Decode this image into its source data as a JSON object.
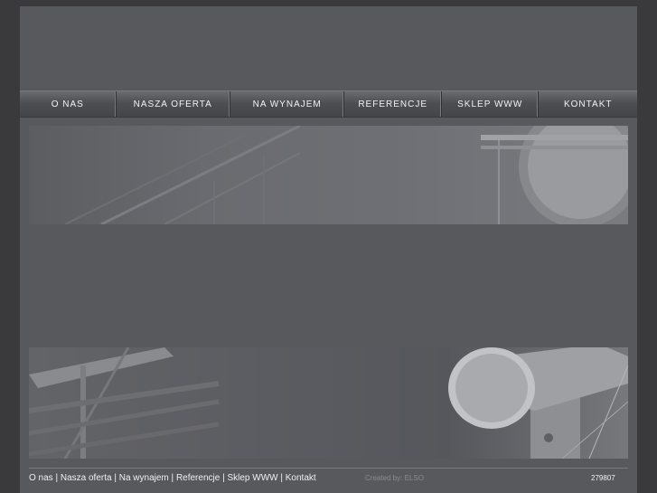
{
  "nav": {
    "items": [
      {
        "label": "O NAS"
      },
      {
        "label": "NASZA OFERTA"
      },
      {
        "label": "NA WYNAJEM"
      },
      {
        "label": "REFERENCJE"
      },
      {
        "label": "SKLEP WWW"
      },
      {
        "label": "KONTAKT"
      }
    ]
  },
  "footer": {
    "links": [
      "O nas",
      "Nasza oferta",
      "Na wynajem",
      "Referencje",
      "Sklep WWW",
      "Kontakt"
    ],
    "separator": "|",
    "created_by": "Created by: ELSO",
    "counter": "279807"
  }
}
